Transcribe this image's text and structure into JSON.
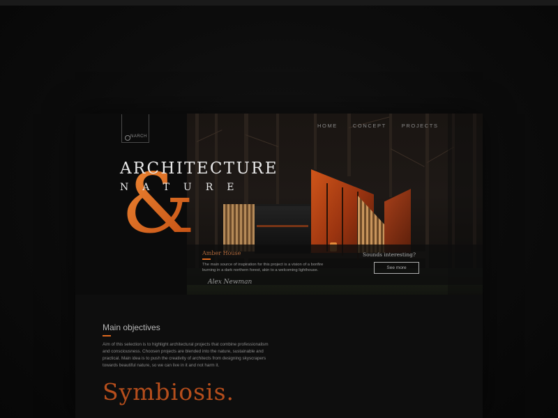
{
  "brand": {
    "logo_text": "NARCH"
  },
  "nav": {
    "items": [
      "HOME",
      "CONCEPT",
      "PROJECTS"
    ]
  },
  "hero": {
    "title_line1": "ARCHITECTURE",
    "title_line2": "NATURE",
    "ampersand": "&",
    "project_title": "Amber House",
    "project_description": "The main source of inspiration for this project is a vision of a bonfire burning in a dark northern forest, akin to a welcoming lighthouse.",
    "signature": "Alex Newman",
    "cta_text": "Sounds interesting?",
    "cta_button": "See more"
  },
  "section": {
    "heading": "Main objectives",
    "body": "Aim of this selection is to highlight architectural projects that combine professionalism and consciousness. Choosen projects are blended into the nature, sustainable and practical. Main idea is to push the creativity of architects from designing skyscrapers towards beautiful nature, so we can live in it and not harm it.",
    "feature_word": "Symbiosis."
  },
  "colors": {
    "accent": "#e06a1f",
    "background": "#0e0e0e",
    "text_light": "#e9e9e9"
  }
}
